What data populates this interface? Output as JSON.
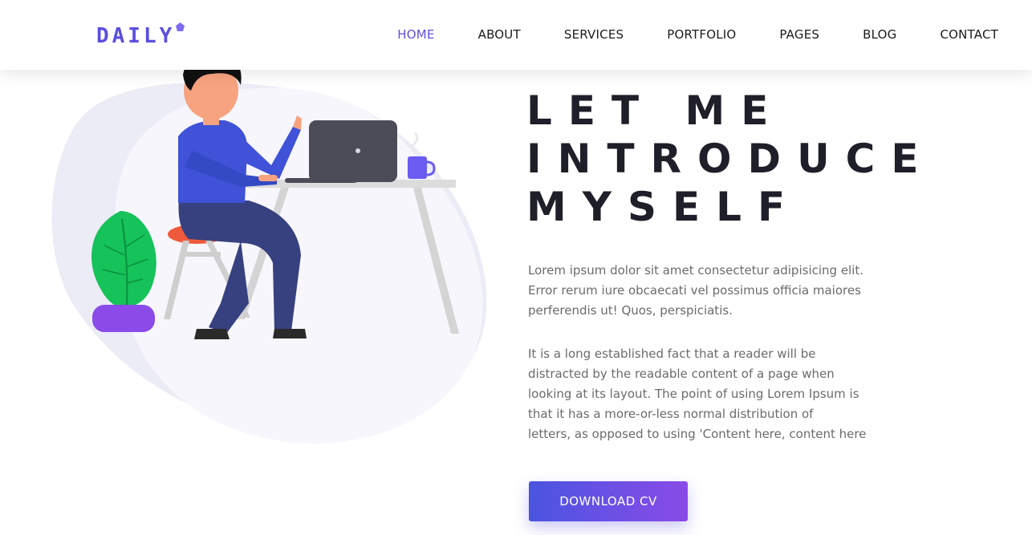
{
  "brand": {
    "logo_text": "DAILY",
    "accent": "#5b4fe0"
  },
  "nav": {
    "items": [
      {
        "label": "HOME",
        "active": true
      },
      {
        "label": "ABOUT"
      },
      {
        "label": "SERVICES"
      },
      {
        "label": "PORTFOLIO"
      },
      {
        "label": "PAGES"
      },
      {
        "label": "BLOG"
      },
      {
        "label": "CONTACT"
      }
    ]
  },
  "hero": {
    "title_lines": [
      "LET ME",
      "INTRODUCE",
      "MYSELF"
    ],
    "paragraph1": "Lorem ipsum dolor sit amet consectetur adipisicing elit. Error rerum iure obcaecati vel possimus officia maiores perferendis ut! Quos, perspiciatis.",
    "paragraph2_lines": [
      "It is a long established fact that a reader will be",
      "distracted by the readable content of a page when",
      "looking at its layout. The point of using Lorem Ipsum is",
      "that it has a more-or-less normal distribution of",
      "letters, as opposed to using 'Content here, content here"
    ],
    "cta_label": "DOWNLOAD CV",
    "illustration": "person-working-at-laptop-illustration"
  }
}
